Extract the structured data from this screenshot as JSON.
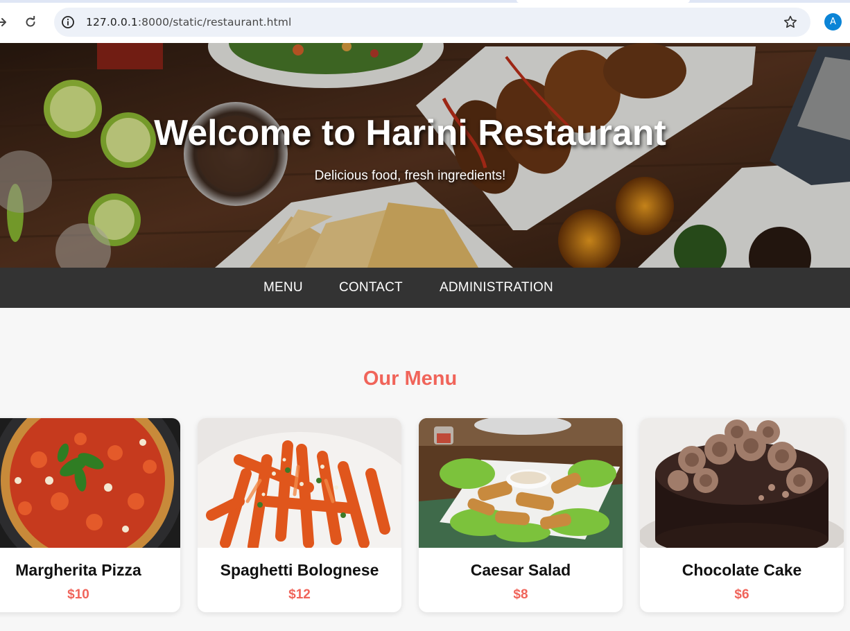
{
  "browser": {
    "url_host": "127.0.0.1",
    "url_rest": ":8000/static/restaurant.html",
    "profile_initial": "A"
  },
  "hero": {
    "title": "Welcome to Harini Restaurant",
    "subtitle": "Delicious food, fresh ingredients!"
  },
  "nav": {
    "items": [
      {
        "label": "MENU"
      },
      {
        "label": "CONTACT"
      },
      {
        "label": "ADMINISTRATION"
      }
    ]
  },
  "menu": {
    "title": "Our Menu",
    "items": [
      {
        "name": "Margherita Pizza",
        "price": "$10"
      },
      {
        "name": "Spaghetti Bolognese",
        "price": "$12"
      },
      {
        "name": "Caesar Salad",
        "price": "$8"
      },
      {
        "name": "Chocolate Cake",
        "price": "$6"
      }
    ]
  },
  "colors": {
    "accent": "#f0645a",
    "nav_bg": "#333333",
    "page_bg": "#f7f7f7"
  }
}
